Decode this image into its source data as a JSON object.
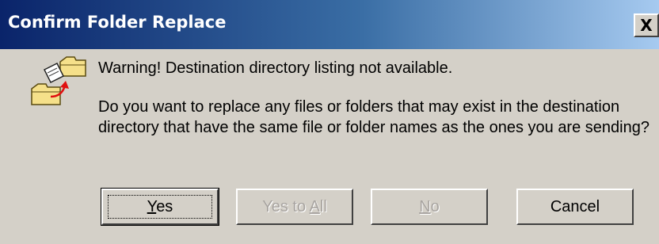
{
  "window": {
    "title": "Confirm Folder Replace",
    "close_label": "X"
  },
  "icon": {
    "name": "folder-replace-icon"
  },
  "message": {
    "warning": "Warning! Destination directory listing not available.",
    "question": "Do you want to replace any files or folders that may exist in the destination directory that have the same file or folder names as the ones you are sending?"
  },
  "buttons": {
    "yes": {
      "label_mnemonic": "Y",
      "label_rest": "es"
    },
    "yes_to_all": {
      "label_pre": "Yes to ",
      "label_mnemonic": "A",
      "label_rest": "ll"
    },
    "no": {
      "label_mnemonic": "N",
      "label_rest": "o"
    },
    "cancel": {
      "label": "Cancel"
    }
  },
  "colors": {
    "titlebar_start": "#0a246a",
    "titlebar_end": "#a6caf0",
    "face": "#d4d0c8",
    "disabled_text": "#a8a4a0"
  }
}
